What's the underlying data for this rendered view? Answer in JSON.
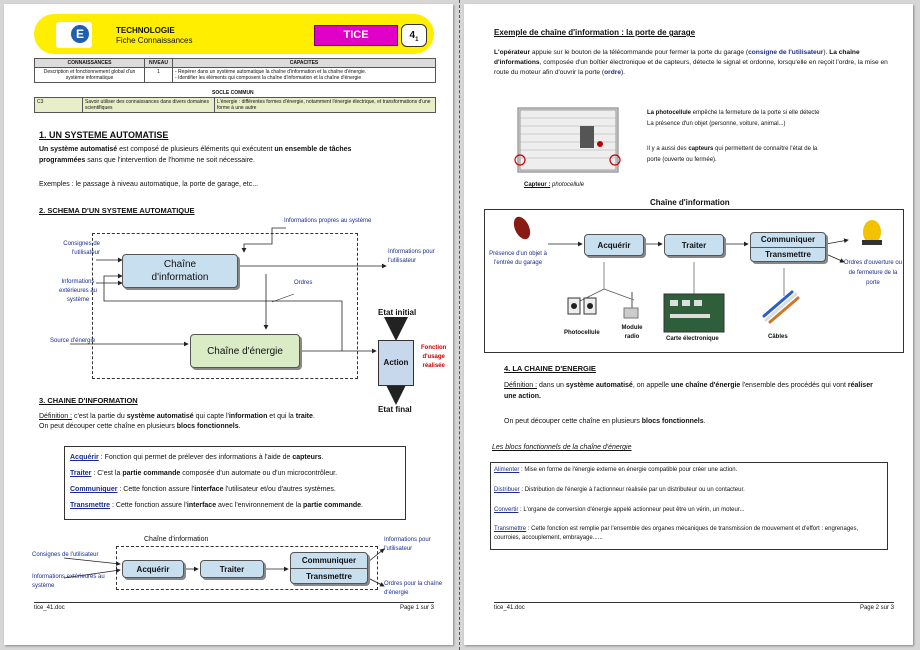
{
  "page1": {
    "header": {
      "logo_text": "E",
      "subject": "TECHNOLOGIE",
      "sheet_type": "Fiche Connaissances",
      "tice": "TICE",
      "number": "4",
      "number_sub": "1"
    },
    "comp_table": {
      "h_conn": "CONNAISSANCES",
      "h_niv": "NIVEAU",
      "h_cap": "CAPACITES",
      "conn": "Description et fonctionnement global d'un système informatique",
      "niv": "1",
      "cap1": "- Repérer dans un système automatique la chaîne d'information et la chaîne d'énergie.",
      "cap2": "- Identifier les éléments qui composent la chaîne d'information et la chaîne d'énergie"
    },
    "socle": {
      "title": "SOCLE COMMUN",
      "code": "C3",
      "mid": "Savoir utiliser des connaissances dans divers domaines scientifiques",
      "right": "L'énergie : différentes formes d'énergie, notamment l'énergie électrique, et transformations d'une forme à une autre"
    },
    "s1": {
      "title": "1. UN SYSTEME AUTOMATISE",
      "p1a": "Un système automatisé",
      "p1b": " est composé de plusieurs éléments qui exécutent ",
      "p1c": "un ensemble de tâches",
      "p1d": "programmées",
      "p1e": " sans que l'intervention de l'homme ne soit nécessaire.",
      "p2": "Exemples : le passage à niveau automatique, la porte de garage, etc..."
    },
    "s2": {
      "title": "2. SCHEMA D'UN SYSTEME AUTOMATIQUE",
      "info_propres": "Informations propres au système",
      "consignes": "Consignes de l'utilisateur",
      "infos_ext": "Informations extérieures au système",
      "source": "Source d'énergie",
      "chaine_info_1": "Chaîne",
      "chaine_info_2": "d'information",
      "ordres": "Ordres",
      "chaine_energie": "Chaîne d'énergie",
      "infos_user": "Informations pour l'utilisateur",
      "etat_initial": "Etat initial",
      "etat_final": "Etat final",
      "action": "Action",
      "fonction_1": "Fonction",
      "fonction_2": "d'usage",
      "fonction_3": "réalisée"
    },
    "s3": {
      "title": "3. CHAINE D'INFORMATION",
      "def_label": "Définition :",
      "def_a": " c'est la partie du ",
      "def_b": "système automatisé",
      "def_c": " qui capte l'",
      "def_d": "information",
      "def_e": " et qui la ",
      "def_f": "traite",
      "def_g": ".",
      "def2a": "On peut découper cette chaîne en plusieurs ",
      "def2b": "blocs fonctionnels",
      "def2c": ".",
      "acq_k": "Acquérir",
      "acq_v1": " : Fonction qui permet de prélever des informations à l'aide de ",
      "acq_v2": "capteurs",
      "acq_v3": ".",
      "tra_k": "Traiter",
      "tra_v1": " : C'est la ",
      "tra_v2": "partie commande",
      "tra_v3": " composée d'un automate ou d'un microcontrôleur.",
      "com_k": "Communiquer",
      "com_v1": " : Cette fonction assure l'",
      "com_v2": "interface",
      "com_v3": " l'utilisateur et/ou d'autres systèmes.",
      "trm_k": "Transmettre",
      "trm_v1": " : Cette fonction assure l'",
      "trm_v2": "interface",
      "trm_v3": " avec l'environnement de la ",
      "trm_v4": "partie commande",
      "trm_v5": "."
    },
    "diag2": {
      "title": "Chaîne d'information",
      "consignes": "Consignes de l'utilisateur",
      "infos_ext": "Informations extérieures au système",
      "acquerir": "Acquérir",
      "traiter": "Traiter",
      "communiquer": "Communiquer",
      "transmettre": "Transmettre",
      "infos_user": "Informations pour l'utilisateur",
      "ordres": "Ordres pour la chaîne d'énergie"
    },
    "footer": {
      "file": "tice_41.doc",
      "page": "Page 1 sur 3"
    }
  },
  "page2": {
    "ex_title": "Exemple de chaîne d'information : la porte de garage",
    "ex_p1": "L'opérateur",
    "ex_p2": " appuie sur le bouton de la télécommande pour fermer la porte du garage (",
    "ex_p3": "consigne de l'utilisateur",
    "ex_p4": "). ",
    "ex_p5": "La chaîne d'informations",
    "ex_p6": ", composée d'un boîtier électronique et de capteurs, détecte le signal et ordonne, lorsqu'elle en reçoit l'ordre, la mise en route du moteur afin d'ouvrir la porte (",
    "ex_p7": "ordre",
    "ex_p8": ").",
    "photo_a": "La photocellule",
    "photo_b": " empêche la fermeture de la porte si elle détecte",
    "photo_c": "La présence d'un objet (personne, voiture, animal...)",
    "capt_a": "Il y a aussi des ",
    "capt_b": "capteurs",
    "capt_c": " qui permettent de connaître l'état de la",
    "capt_d": "porte (ouverte ou fermée).",
    "caption_k": "Capteur :",
    "caption_v": " photocellule",
    "chain": {
      "title": "Chaîne d'information",
      "presence": "Présence d'un objet à l'entrée du garage",
      "acquerir": "Acquérir",
      "traiter": "Traiter",
      "communiquer": "Communiquer",
      "transmettre": "Transmettre",
      "ordres": "Ordres d'ouverture ou de fermeture de la porte",
      "photocellule": "Photocellule",
      "module": "Module radio",
      "carte": "Carte électronique",
      "cables": "Câbles"
    },
    "s4": {
      "title": "4. LA CHAINE D'ENERGIE",
      "def_label": "Définition :",
      "def_a": " dans un ",
      "def_b": "système automatisé",
      "def_c": ", on appelle ",
      "def_d": "une chaîne d'énergie",
      "def_e": " l'ensemble des procédés qui vont ",
      "def_f": "réaliser une action.",
      "p2a": "On peut découper cette chaîne en plusieurs ",
      "p2b": "blocs fonctionnels",
      "p2c": ".",
      "blocs_title": "Les blocs fonctionnels de la chaîne d'énergie",
      "ali_k": "Alimenter",
      "ali_v": " : Mise en forme de l'énergie externe en énergie compatible pour créer une action.",
      "dis_k": "Distribuer",
      "dis_v": " : Distribution de l'énergie à l'actionneur réalisée par un distributeur ou un contacteur.",
      "con_k": "Convertir",
      "con_v": " : L'organe de conversion d'énergie appelé actionneur peut être un vérin, un moteur...",
      "tra_k": "Transmettre",
      "tra_v": " : Cette fonction est remplie par l'ensemble des organes mécaniques de transmission de mouvement et d'effort : engrenages, courroies, accouplement, embrayage......"
    },
    "footer": {
      "file": "tice_41.doc",
      "page": "Page 2 sur 3"
    }
  },
  "colors": {
    "yellow": "#ffee00",
    "magenta": "#e000c8",
    "blue_block": "#c8dff0",
    "green_block": "#d9ecc6",
    "link_blue": "#1a2d8f",
    "red": "#cc0000"
  }
}
